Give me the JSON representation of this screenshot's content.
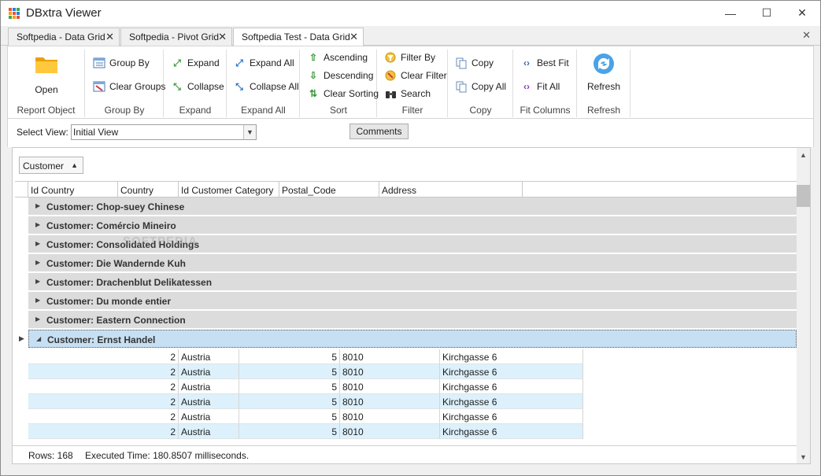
{
  "window": {
    "title": "DBxtra Viewer",
    "controls": {
      "minimize": "—",
      "maximize": "☐",
      "close": "✕"
    },
    "icon_colors": [
      "#e4572e",
      "#2c7bd6",
      "#3aa655",
      "#f0a020",
      "#e4572e",
      "#2c7bd6",
      "#3aa655",
      "#f0a020",
      "#e4572e"
    ]
  },
  "doc_tabs": [
    {
      "label": "Softpedia - Data Grid",
      "active": false
    },
    {
      "label": "Softpedia - Pivot Grid",
      "active": false
    },
    {
      "label": "Softpedia Test - Data Grid",
      "active": true
    }
  ],
  "tabstrip_close": "✕",
  "ribbon": {
    "groups": {
      "report_object": {
        "label": "Report Object",
        "open": "Open"
      },
      "group_by": {
        "label": "Group By",
        "group_by": "Group By",
        "clear_groups": "Clear Groups"
      },
      "expand": {
        "label": "Expand",
        "expand": "Expand",
        "collapse": "Collapse"
      },
      "expand_all": {
        "label": "Expand All",
        "expand_all": "Expand All",
        "collapse_all": "Collapse All"
      },
      "sort": {
        "label": "Sort",
        "ascending": "Ascending",
        "descending": "Descending",
        "clear_sorting": "Clear Sorting"
      },
      "filter": {
        "label": "Filter",
        "filter_by": "Filter By",
        "clear_filter": "Clear Filter",
        "search": "Search"
      },
      "copy": {
        "label": "Copy",
        "copy": "Copy",
        "copy_all": "Copy All"
      },
      "fit_columns": {
        "label": "Fit Columns",
        "best_fit": "Best Fit",
        "fit_all": "Fit All"
      },
      "refresh": {
        "label": "Refresh",
        "refresh": "Refresh"
      }
    }
  },
  "view": {
    "label": "Select View:",
    "selected": "Initial View",
    "comments_button": "Comments"
  },
  "grid": {
    "group_panel": {
      "field": "Customer",
      "sort": "ascending"
    },
    "columns": [
      "Id Country",
      "Country",
      "Id Customer Category",
      "Postal_Code",
      "Address"
    ],
    "groups": [
      {
        "label": "Customer: Chop-suey Chinese",
        "expanded": false,
        "selected": false
      },
      {
        "label": "Customer: Comércio Mineiro",
        "expanded": false,
        "selected": false
      },
      {
        "label": "Customer: Consolidated Holdings",
        "expanded": false,
        "selected": false
      },
      {
        "label": "Customer: Die Wandernde Kuh",
        "expanded": false,
        "selected": false
      },
      {
        "label": "Customer: Drachenblut Delikatessen",
        "expanded": false,
        "selected": false
      },
      {
        "label": "Customer: Du monde entier",
        "expanded": false,
        "selected": false
      },
      {
        "label": "Customer: Eastern Connection",
        "expanded": false,
        "selected": false
      },
      {
        "label": "Customer: Ernst Handel",
        "expanded": true,
        "selected": true
      }
    ],
    "rows": [
      [
        "2",
        "Austria",
        "5",
        "8010",
        "Kirchgasse 6"
      ],
      [
        "2",
        "Austria",
        "5",
        "8010",
        "Kirchgasse 6"
      ],
      [
        "2",
        "Austria",
        "5",
        "8010",
        "Kirchgasse 6"
      ],
      [
        "2",
        "Austria",
        "5",
        "8010",
        "Kirchgasse 6"
      ],
      [
        "2",
        "Austria",
        "5",
        "8010",
        "Kirchgasse 6"
      ],
      [
        "2",
        "Austria",
        "5",
        "8010",
        "Kirchgasse 6"
      ]
    ]
  },
  "status": {
    "rows": "Rows: 168",
    "executed": "Executed Time: 180.8507 milliseconds."
  },
  "watermark": "SOFTPEDIA"
}
